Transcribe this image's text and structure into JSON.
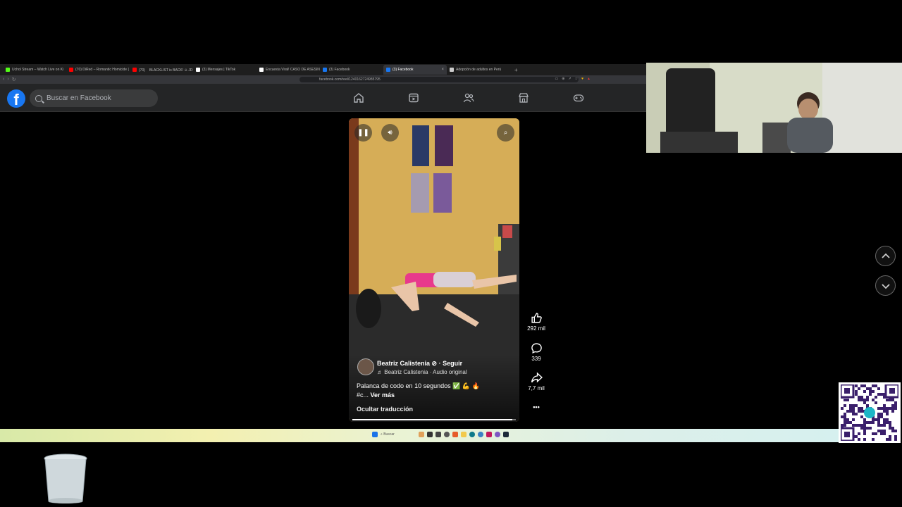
{
  "browser": {
    "tabs": [
      {
        "title": "Uchol Stream – Watch Live on Ki",
        "color": "#53fc18",
        "active": false
      },
      {
        "title": "(70) DiRed – Romantic Homicide | Su",
        "color": "#ff0000",
        "active": false
      },
      {
        "title": "(70) ㅤBLACKLIST is BACK! ☠ JD",
        "color": "#ff0000",
        "active": false
      },
      {
        "title": "(3) Mensajes | TikTok",
        "color": "#ffffff",
        "active": false
      },
      {
        "title": "Encuesta Viral! CASO DE ASESINAT",
        "color": "#ffffff",
        "active": false
      },
      {
        "title": "(3) Facebook",
        "color": "#1877f2",
        "active": false
      },
      {
        "title": "(3) Facebook",
        "color": "#1877f2",
        "active": true
      },
      {
        "title": "Adopción de adultos en Perú",
        "color": "#cccccc",
        "active": false
      }
    ],
    "url": "facebook.com/reel/1240162724985795"
  },
  "facebook": {
    "logo": "f",
    "search_placeholder": "Buscar en Facebook",
    "nav_icons": [
      "home-icon",
      "video-icon",
      "friends-icon",
      "marketplace-icon",
      "gaming-icon"
    ]
  },
  "reel": {
    "author": "Beatriz Calistenia",
    "follow": "· Seguir",
    "audio": "Beatriz Calistenia · Audio original",
    "caption": "Palanca de codo en 10 segundos ✅ 💪 🔥",
    "hashtag": "#c...",
    "see_more": "Ver más",
    "hide_translation": "Ocultar traducción",
    "progress": 0.98
  },
  "actions": {
    "likes": "292 mil",
    "comments": "339",
    "shares": "7,7 mil",
    "more": "•••"
  },
  "taskbar": {
    "search": "Buscar"
  },
  "colors": {
    "fb_blue": "#1877f2",
    "header_bg": "#242526",
    "wall": "#d9b35c"
  }
}
